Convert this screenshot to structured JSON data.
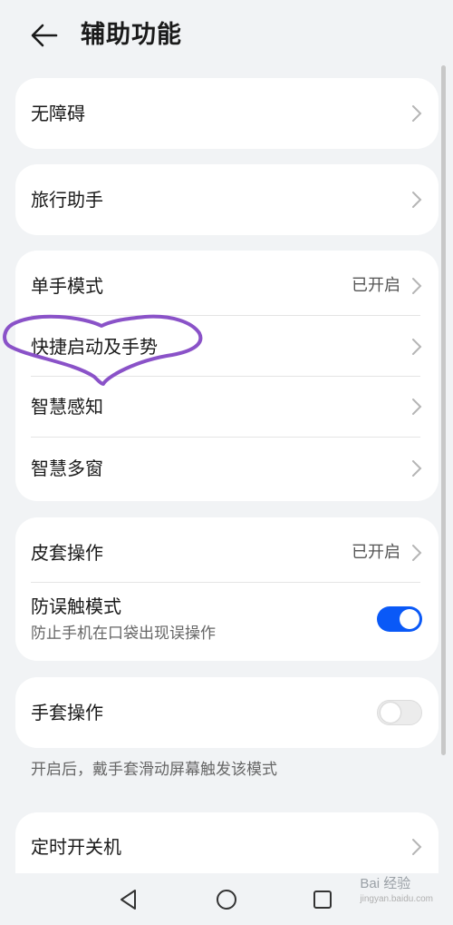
{
  "header": {
    "title": "辅助功能",
    "back_icon": "arrow-left-icon"
  },
  "accessibility_card": {
    "label": "无障碍"
  },
  "travel_card": {
    "label": "旅行助手"
  },
  "features_card": {
    "one_hand": {
      "label": "单手模式",
      "value": "已开启"
    },
    "shortcuts": {
      "label": "快捷启动及手势"
    },
    "smart_sense": {
      "label": "智慧感知"
    },
    "multi_window": {
      "label": "智慧多窗"
    }
  },
  "cover_card": {
    "cover_ops": {
      "label": "皮套操作",
      "value": "已开启"
    },
    "anti_touch": {
      "label": "防误触模式",
      "description": "防止手机在口袋出现误操作",
      "enabled": true
    }
  },
  "glove_card": {
    "label": "手套操作",
    "enabled": false
  },
  "glove_note": "开启后，戴手套滑动屏幕触发该模式",
  "schedule_card": {
    "label": "定时开关机"
  },
  "highlight": {
    "shape": "heart-outline",
    "color": "#8a52c8"
  },
  "colors": {
    "accent": "#0a59f7",
    "background": "#f1f3f5",
    "card": "#ffffff"
  },
  "navbar": {
    "back": "triangle-back-icon",
    "home": "circle-home-icon",
    "recents": "square-recents-icon"
  },
  "watermark": {
    "brand": "Bai 经验",
    "url": "jingyan.baidu.com"
  }
}
